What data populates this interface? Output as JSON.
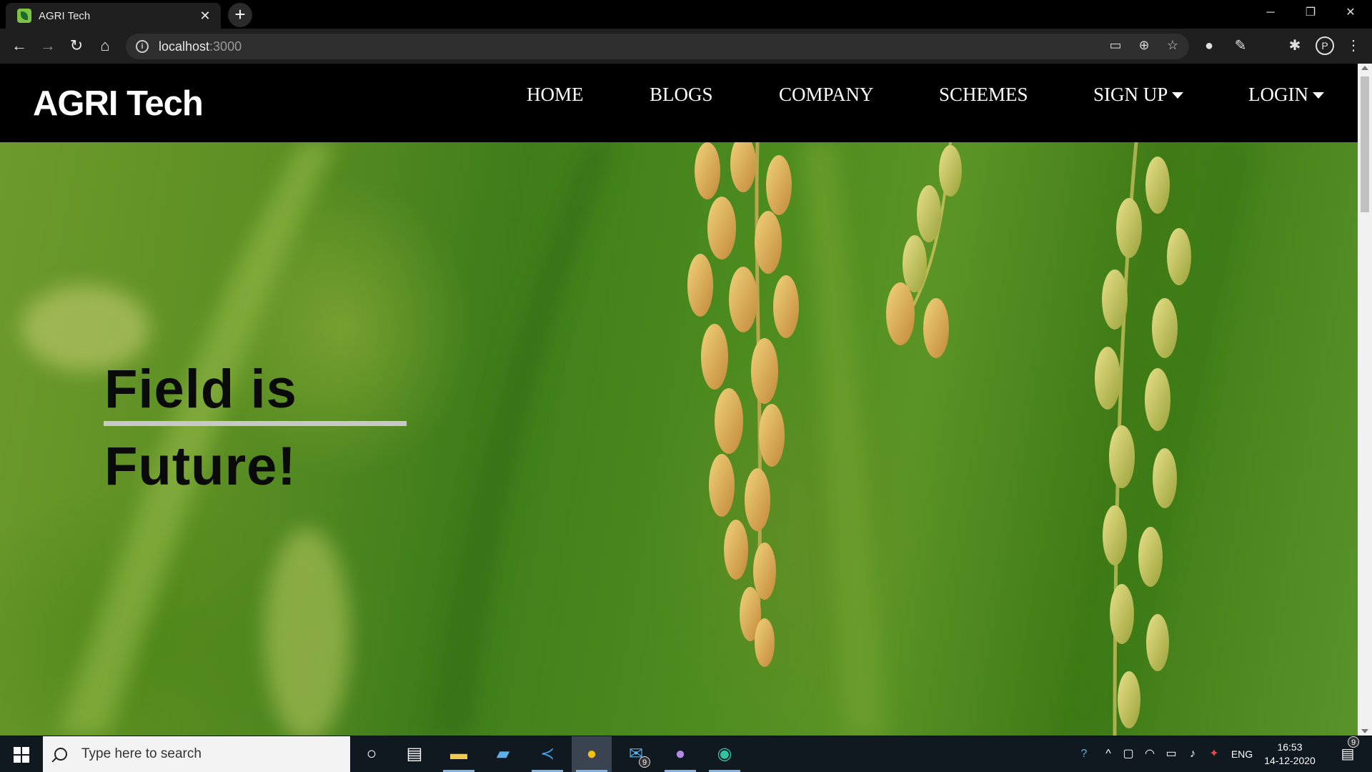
{
  "browser": {
    "tab_title": "AGRI Tech",
    "tab_close": "✕",
    "new_tab": "+",
    "url_host": "localhost",
    "url_port": ":3000",
    "window": {
      "minimize": "─",
      "restore": "❐",
      "close": "✕"
    },
    "nav": {
      "back": "←",
      "forward": "→",
      "reload": "↻",
      "home": "⌂"
    },
    "profile_initial": "P"
  },
  "site": {
    "brand": "AGRI Tech",
    "menu": [
      {
        "label": "HOME",
        "has_dropdown": false
      },
      {
        "label": "BLOGS",
        "has_dropdown": false
      },
      {
        "label": "COMPANY",
        "has_dropdown": false
      },
      {
        "label": "SCHEMES",
        "has_dropdown": false
      },
      {
        "label": "SIGN UP",
        "has_dropdown": true
      },
      {
        "label": "LOGIN",
        "has_dropdown": true
      }
    ],
    "hero": {
      "line1": "Field is",
      "line2": "Future!"
    }
  },
  "taskbar": {
    "search_placeholder": "Type here to search",
    "apps": [
      {
        "name": "cortana-icon",
        "active": false
      },
      {
        "name": "task-view-icon",
        "active": false
      },
      {
        "name": "file-explorer-icon",
        "active": false
      },
      {
        "name": "remote-desktop-icon",
        "active": false
      },
      {
        "name": "vscode-icon",
        "active": false
      },
      {
        "name": "chrome-icon",
        "active": true
      },
      {
        "name": "mail-icon",
        "active": false,
        "badge": "9"
      },
      {
        "name": "github-desktop-icon",
        "active": false
      },
      {
        "name": "edge-icon",
        "active": false
      }
    ],
    "tray": {
      "language": "ENG",
      "time": "16:53",
      "date": "14-12-2020",
      "notifications": "9"
    }
  },
  "colors": {
    "nav_bg": "#000000",
    "brand_text": "#ffffff",
    "hero_text": "#0a0a0a",
    "rule": "#c8c8c8",
    "hero_green": "#4b8a1e",
    "grain": "#d8b25a"
  }
}
